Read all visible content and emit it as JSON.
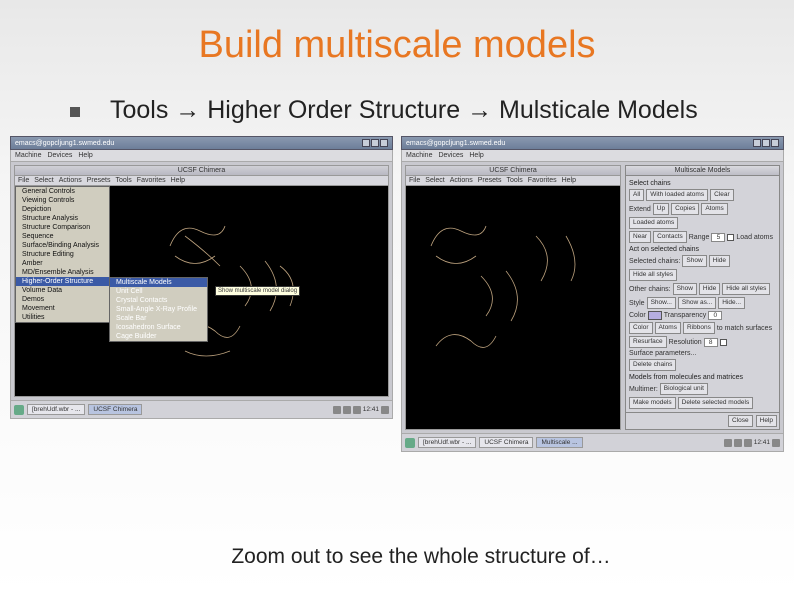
{
  "slide": {
    "title": "Build multiscale models",
    "bullet": "Tools → Higher Order Structure → Mulsticale Models",
    "footer": "Zoom out to see the whole structure of…"
  },
  "left_screen": {
    "titlebar": "emacs@gopcljung1.swmed.edu",
    "host_menu": [
      "Machine",
      "Devices",
      "Help"
    ],
    "chimera_title": "UCSF Chimera",
    "chimera_menu": [
      "File",
      "Select",
      "Actions",
      "Presets",
      "Tools",
      "Favorites",
      "Help"
    ],
    "tools_menu": [
      "General Controls",
      "Viewing Controls",
      "Depiction",
      "Structure Analysis",
      "Structure Comparison",
      "Sequence",
      "Surface/Binding Analysis",
      "Structure Editing",
      "Amber",
      "MD/Ensemble Analysis",
      "Higher-Order Structure",
      "Volume Data",
      "Demos",
      "Movement",
      "Utilities"
    ],
    "tools_highlighted": "Higher-Order Structure",
    "submenu_items": [
      "Multiscale Models",
      "Unit Cell",
      "Crystal Contacts",
      "Small-Angle X-Ray Profile",
      "Scale Bar",
      "Icosahedron Surface",
      "Cage Builder"
    ],
    "submenu_highlighted": "Multiscale Models",
    "tooltip": "Show multiscale model dialog",
    "taskbar": {
      "items": [
        "[brehUdf.wbr - ...",
        "UCSF Chimera"
      ],
      "clock": "12:41"
    }
  },
  "right_screen": {
    "titlebar": "emacs@gopcljung1.swmed.edu",
    "host_menu": [
      "Machine",
      "Devices",
      "Help"
    ],
    "chimera_title": "UCSF Chimera",
    "chimera_menu": [
      "File",
      "Select",
      "Actions",
      "Presets",
      "Tools",
      "Favorites",
      "Help"
    ],
    "panel_title": "Multiscale Models",
    "select_chains": {
      "label": "Select chains",
      "all": "All",
      "with_loaded": "With loaded atoms",
      "clear": "Clear"
    },
    "extend_row": {
      "extend": "Extend",
      "up": "Up",
      "copies": "Copies",
      "atoms": "Atoms",
      "loaded_atoms": "Loaded atoms"
    },
    "near_row": {
      "near": "Near",
      "contacts": "Contacts",
      "range_label": "Range",
      "range_value": "5",
      "load_atoms": "Load atoms"
    },
    "act": {
      "label": "Act on selected chains",
      "selected_chains": "Selected chains:",
      "show": "Show",
      "hide": "Hide",
      "hide_all_styles": "Hide all styles",
      "other_chains": "Other chains:",
      "style_label": "Style",
      "style_show": "Show...",
      "style_show_as": "Show as...",
      "style_hide": "Hide...",
      "color_label": "Color",
      "transparency_label": "Transparency",
      "transparency_value": "0",
      "color": "Color",
      "atoms": "Atoms",
      "ribbons": "Ribbons",
      "match_surfaces": "to match surfaces",
      "resurface": "Resurface",
      "resolution_label": "Resolution",
      "resolution_value": "8",
      "surface_params": "Surface parameters...",
      "delete_chains": "Delete chains"
    },
    "models": {
      "label": "Models from molecules and matrices",
      "multimer": "Multimer:",
      "multimer_value": "Biological unit",
      "make_models": "Make models",
      "delete_selected": "Delete selected models"
    },
    "footer_buttons": {
      "close": "Close",
      "help": "Help"
    },
    "taskbar": {
      "items": [
        "[brehUdf.wbr - ...",
        "UCSF Chimera",
        "Multiscale ..."
      ],
      "clock": "12:41"
    }
  }
}
